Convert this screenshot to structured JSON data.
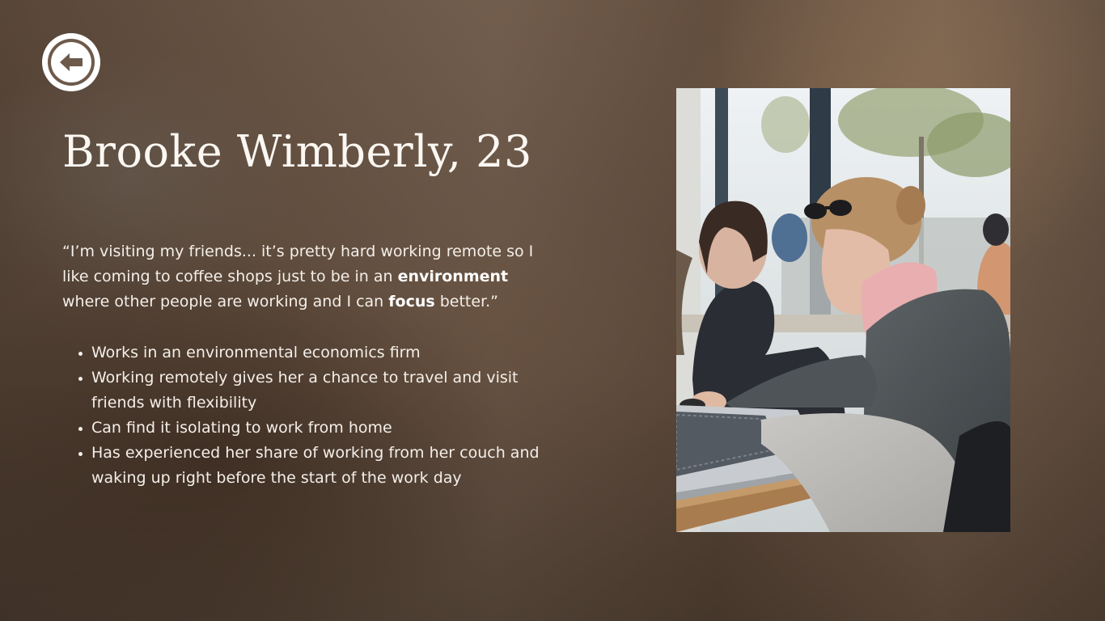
{
  "navigation": {
    "back_icon": "arrow-left-circle-icon"
  },
  "profile": {
    "title": "Brooke Wimberly, 23",
    "quote": {
      "part1": "“I’m visiting my friends... it’s pretty hard working remote so I like coming to coffee shops just to be in an ",
      "bold1": "environment",
      "part2": " where other people are working and I can ",
      "bold2": "focus",
      "part3": " better.”"
    },
    "facts": [
      "Works in an environmental economics firm",
      "Working remotely gives her a chance to travel and visit friends with flexibility",
      "Can find it isolating to work from home",
      "Has experienced her share of working from her couch and waking up right before the start of the work day"
    ]
  },
  "colors": {
    "text": "#ffffff",
    "background": "#6f5a49",
    "accent_brown": "#6e5a4b"
  }
}
